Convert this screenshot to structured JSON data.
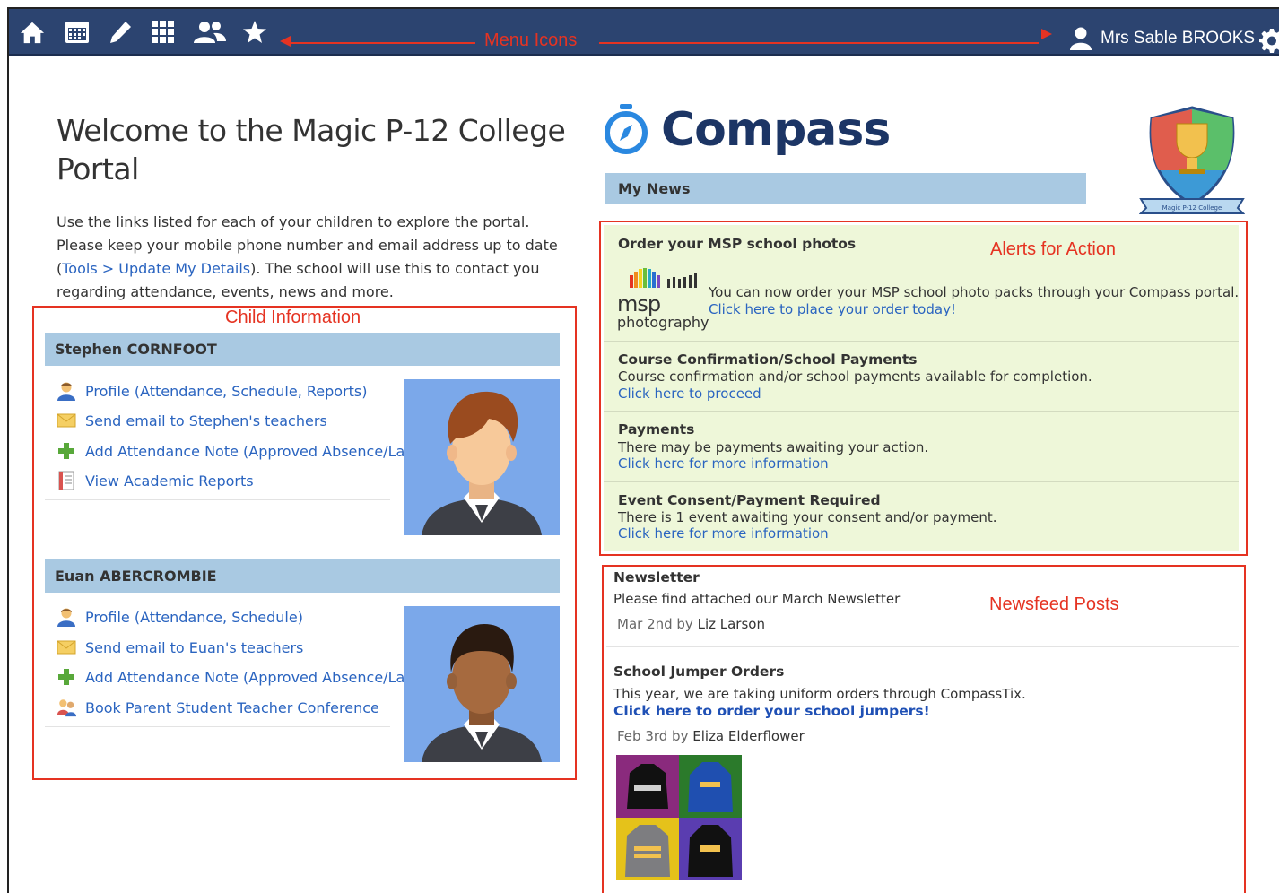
{
  "topbar": {
    "annotation": "Menu Icons",
    "icons": [
      "home-icon",
      "calendar-icon",
      "pencil-icon",
      "grid-icon",
      "people-icon",
      "star-icon"
    ],
    "user_name": "Mrs Sable BROOKS"
  },
  "welcome": {
    "title": "Welcome to the Magic P-12 College Portal",
    "intro_1": "Use the links listed for each of your children to explore the portal. Please keep your mobile phone number and email address up to date (",
    "intro_link_tools": "Tools",
    "intro_sep": " > ",
    "intro_link_update": "Update My Details",
    "intro_2": "). The school will use this to contact you regarding attendance, events, news and more."
  },
  "child_section": {
    "annotation": "Child Information",
    "children": [
      {
        "name": "Stephen CORNFOOT",
        "links": [
          "Profile (Attendance, Schedule, Reports)",
          "Send email to Stephen's teachers",
          "Add Attendance Note (Approved Absence/Late)",
          "View Academic Reports"
        ]
      },
      {
        "name": "Euan ABERCROMBIE",
        "links": [
          "Profile (Attendance, Schedule)",
          "Send email to Euan's teachers",
          "Add Attendance Note (Approved Absence/Late)",
          "Book Parent Student Teacher Conference"
        ]
      }
    ]
  },
  "brand": {
    "name": "Compass",
    "crest_text": "Magic P-12 College"
  },
  "my_news": {
    "label": "My News"
  },
  "alerts": {
    "annotation": "Alerts for Action",
    "msp_logo_top": "msp",
    "msp_logo_bottom": "photography",
    "items": [
      {
        "title": "Order your MSP school photos",
        "text": "You can now order your MSP school photo packs through your Compass portal.",
        "link": "Click here to place your order today!"
      },
      {
        "title": "Course Confirmation/School Payments",
        "text": "Course confirmation and/or school payments available for completion.",
        "link": "Click here to proceed"
      },
      {
        "title": "Payments",
        "text": "There may be payments awaiting your action.",
        "link": "Click here for more information"
      },
      {
        "title": "Event Consent/Payment Required",
        "text": "There is 1 event awaiting your consent and/or payment.",
        "link": "Click here for more information"
      }
    ]
  },
  "newsfeed": {
    "annotation": "Newsfeed Posts",
    "posts": [
      {
        "title": "Newsletter",
        "text": "Please find attached our March Newsletter",
        "date": "Mar 2nd by",
        "author": "Liz Larson"
      },
      {
        "title": "School Jumper Orders",
        "text": "This year, we are taking uniform orders through CompassTix.",
        "link": "Click here to order your school jumpers!",
        "date": "Feb 3rd by",
        "author": "Eliza Elderflower"
      }
    ]
  }
}
